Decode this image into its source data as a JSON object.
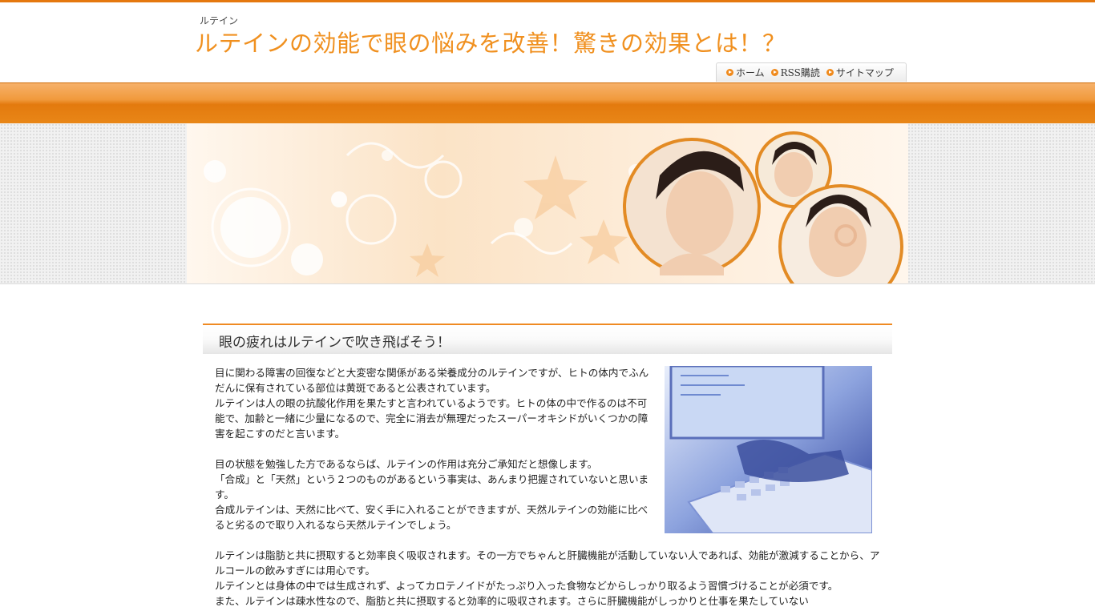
{
  "header": {
    "site_small": "ルテイン",
    "site_title": "ルテインの効能で眼の悩みを改善！驚きの効果とは！？"
  },
  "nav": {
    "items": [
      {
        "label": "ホーム",
        "icon": "arrow-bullet-icon"
      },
      {
        "label": "RSS購読",
        "icon": "arrow-bullet-icon"
      },
      {
        "label": "サイトマップ",
        "icon": "arrow-bullet-icon"
      }
    ]
  },
  "article": {
    "heading": "眼の疲れはルテインで吹き飛ばそう！",
    "para1": "目に関わる障害の回復などと大変密な関係がある栄養成分のルテインですが、ヒトの体内でふんだんに保有されている部位は黄斑であると公表されています。",
    "para2": "ルテインは人の眼の抗酸化作用を果たすと言われているようです。ヒトの体の中で作るのは不可能で、加齢と一緒に少量になるので、完全に消去が無理だったスーパーオキシドがいくつかの障害を起こすのだと言います。",
    "para3": "目の状態を勉強した方であるならば、ルテインの作用は充分ご承知だと想像します。",
    "para4": "「合成」と「天然」という２つのものがあるという事実は、あんまり把握されていないと思います。",
    "para5": "合成ルテインは、天然に比べて、安く手に入れることができますが、天然ルテインの効能に比べると劣るので取り入れるなら天然ルテインでしょう。",
    "para6": "ルテインは脂肪と共に摂取すると効率良く吸収されます。その一方でちゃんと肝臓機能が活動していない人であれば、効能が激減することから、アルコールの飲みすぎには用心です。",
    "para7": "ルテインとは身体の中では生成されず、よってカロテノイドがたっぷり入った食物などからしっかり取るよう習慣づけることが必須です。",
    "para8": "また、ルテインは疎水性なので、脂肪と共に摂取すると効率的に吸収されます。さらに肝臓機能がしっかりと仕事を果たしていない"
  },
  "colors": {
    "accent": "#e5780e",
    "title": "#f0901f"
  }
}
